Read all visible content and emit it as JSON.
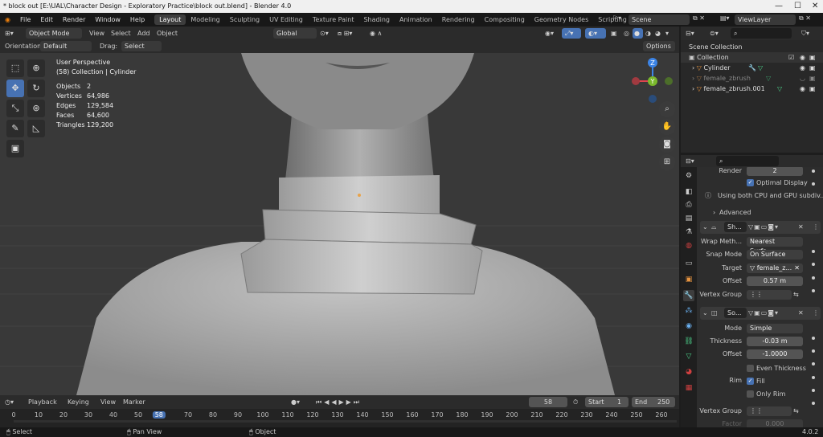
{
  "window": {
    "title": "* block out [E:\\UAL\\Character Design - Exploratory Practice\\block out.blend] - Blender 4.0"
  },
  "menu": {
    "items": [
      "File",
      "Edit",
      "Render",
      "Window",
      "Help"
    ]
  },
  "workspaces": [
    "Layout",
    "Modeling",
    "Sculpting",
    "UV Editing",
    "Texture Paint",
    "Shading",
    "Animation",
    "Rendering",
    "Compositing",
    "Geometry Nodes",
    "Scripting"
  ],
  "workspace_add": "+",
  "scene": {
    "name": "Scene",
    "view_layer": "ViewLayer"
  },
  "viewport_header": {
    "mode": "Object Mode",
    "view": "View",
    "select": "Select",
    "add": "Add",
    "object": "Object",
    "transform_orientation": "Global"
  },
  "tool_settings": {
    "orientation_label": "Orientation:",
    "orientation": "Default",
    "drag_label": "Drag:",
    "drag": "Select Box",
    "options": "Options"
  },
  "overlay_info": {
    "view_name": "User Perspective",
    "collection": "(58) Collection | Cylinder",
    "stats": [
      {
        "label": "Objects",
        "value": "2"
      },
      {
        "label": "Vertices",
        "value": "64,986"
      },
      {
        "label": "Edges",
        "value": "129,584"
      },
      {
        "label": "Faces",
        "value": "64,600"
      },
      {
        "label": "Triangles",
        "value": "129,200"
      }
    ]
  },
  "gizmo": {
    "x": "X",
    "y": "Y",
    "z": "Z"
  },
  "timeline": {
    "playback": "Playback",
    "keying": "Keying",
    "view": "View",
    "marker": "Marker",
    "current_frame": "58",
    "start_label": "Start",
    "start": "1",
    "end_label": "End",
    "end": "250",
    "ticks": [
      "0",
      "10",
      "20",
      "30",
      "40",
      "50",
      "58",
      "70",
      "80",
      "90",
      "100",
      "110",
      "120",
      "130",
      "140",
      "150",
      "160",
      "170",
      "180",
      "190",
      "200",
      "210",
      "220",
      "230",
      "240",
      "250",
      "260"
    ]
  },
  "status_bar": {
    "select": "Select",
    "pan": "Pan View",
    "object": "Object",
    "version": "4.0.2"
  },
  "outliner": {
    "root": "Scene Collection",
    "collection": "Collection",
    "items": [
      "Cylinder",
      "female_zbrush",
      "female_zbrush.001"
    ]
  },
  "properties": {
    "render_label": "Render",
    "render_value": "2",
    "optimal_display": "Optimal Display",
    "info": "Using both CPU and GPU subdiv...",
    "advanced": "Advanced",
    "shrinkwrap": {
      "name": "Sh...",
      "wrap_method_label": "Wrap Meth...",
      "wrap_method": "Nearest Surfa...",
      "snap_mode_label": "Snap Mode",
      "snap_mode": "On Surface",
      "target_label": "Target",
      "target": "female_z...",
      "offset_label": "Offset",
      "offset": "0.57 m",
      "vgroup_label": "Vertex Group"
    },
    "solidify": {
      "name": "So...",
      "mode_label": "Mode",
      "mode": "Simple",
      "thickness_label": "Thickness",
      "thickness": "-0.03 m",
      "offset_label": "Offset",
      "offset": "-1.0000",
      "even_thickness": "Even Thickness",
      "rim_label": "Rim",
      "fill": "Fill",
      "only_rim": "Only Rim",
      "vgroup_label": "Vertex Group",
      "factor_label": "Factor",
      "factor": "0.000"
    }
  },
  "colors": {
    "accent": "#4772b3",
    "x_axis": "#e0454e",
    "y_axis": "#7ab82c",
    "z_axis": "#3c84e6"
  }
}
